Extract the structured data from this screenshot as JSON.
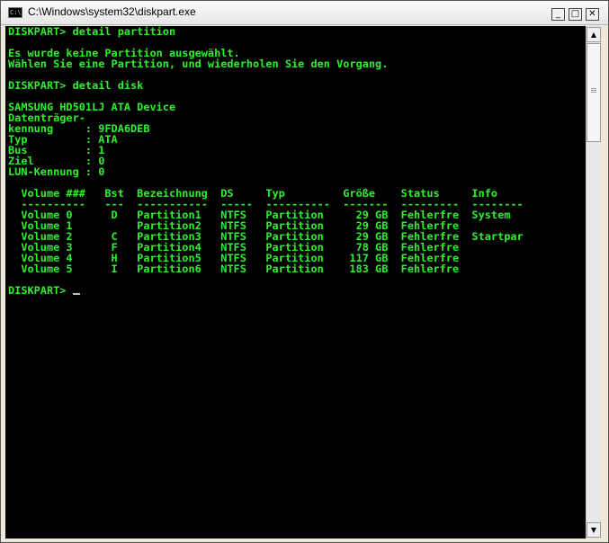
{
  "window": {
    "title": "C:\\Windows\\system32\\diskpart.exe",
    "icon_label": "C:\\",
    "controls": {
      "minimize": "_",
      "maximize": "□",
      "close": "✕"
    }
  },
  "console": {
    "lines": [
      "DISKPART> detail partition",
      "",
      "Es wurde keine Partition ausgewählt.",
      "Wählen Sie eine Partition, und wiederholen Sie den Vorgang.",
      "",
      "DISKPART> detail disk",
      "",
      "SAMSUNG HD501LJ ATA Device",
      "Datenträger-",
      "kennung     : 9FDA6DEB",
      "Typ         : ATA",
      "Bus         : 1",
      "Ziel        : 0",
      "LUN-Kennung : 0",
      "",
      "  Volume ###   Bst  Bezeichnung  DS     Typ         Größe    Status     Info",
      "  ----------   ---  -----------  -----  ----------  -------  ---------  --------",
      "  Volume 0      D   Partition1   NTFS   Partition     29 GB  Fehlerfre  System",
      "  Volume 1          Partition2   NTFS   Partition     29 GB  Fehlerfre",
      "  Volume 2      C   Partition3   NTFS   Partition     29 GB  Fehlerfre  Startpar",
      "  Volume 3      F   Partition4   NTFS   Partition     78 GB  Fehlerfre",
      "  Volume 4      H   Partition5   NTFS   Partition    117 GB  Fehlerfre",
      "  Volume 5      I   Partition6   NTFS   Partition    183 GB  Fehlerfre",
      ""
    ],
    "prompt": "DISKPART> "
  },
  "colors": {
    "console_text": "#2bf22b",
    "console_background": "#000000"
  },
  "scrollbar": {
    "up_arrow": "▲",
    "down_arrow": "▼"
  }
}
